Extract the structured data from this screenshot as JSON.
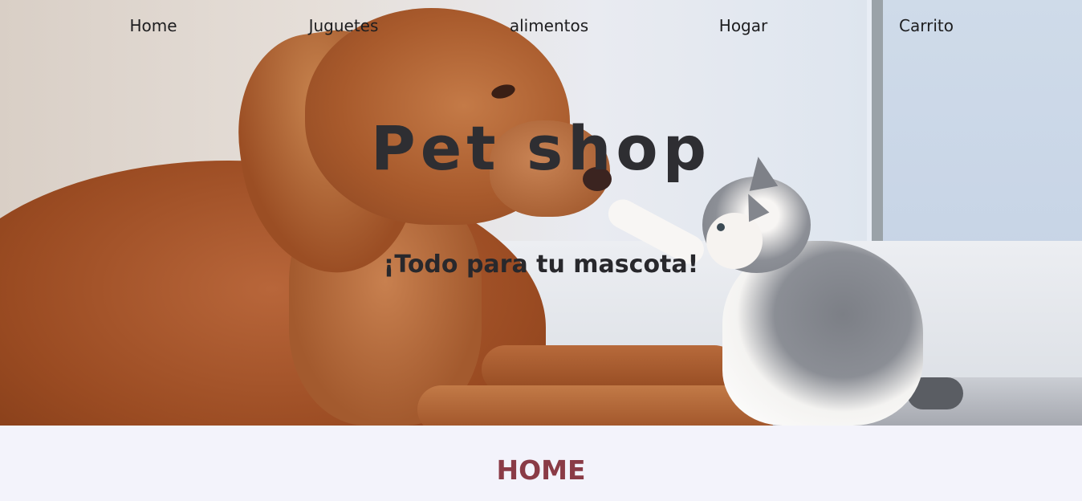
{
  "nav": {
    "items": [
      {
        "label": "Home"
      },
      {
        "label": "Juguetes"
      },
      {
        "label": "alimentos"
      },
      {
        "label": "Hogar"
      },
      {
        "label": "Carrito"
      }
    ]
  },
  "hero": {
    "title": "Pet shop",
    "subtitle": "¡Todo para tu mascota!"
  },
  "main": {
    "section_heading": "HOME"
  },
  "colors": {
    "nav_text": "#1d1d1f",
    "title_text": "#2e2e32",
    "section_heading": "#8a3b46",
    "page_background": "#f3f3fb"
  }
}
